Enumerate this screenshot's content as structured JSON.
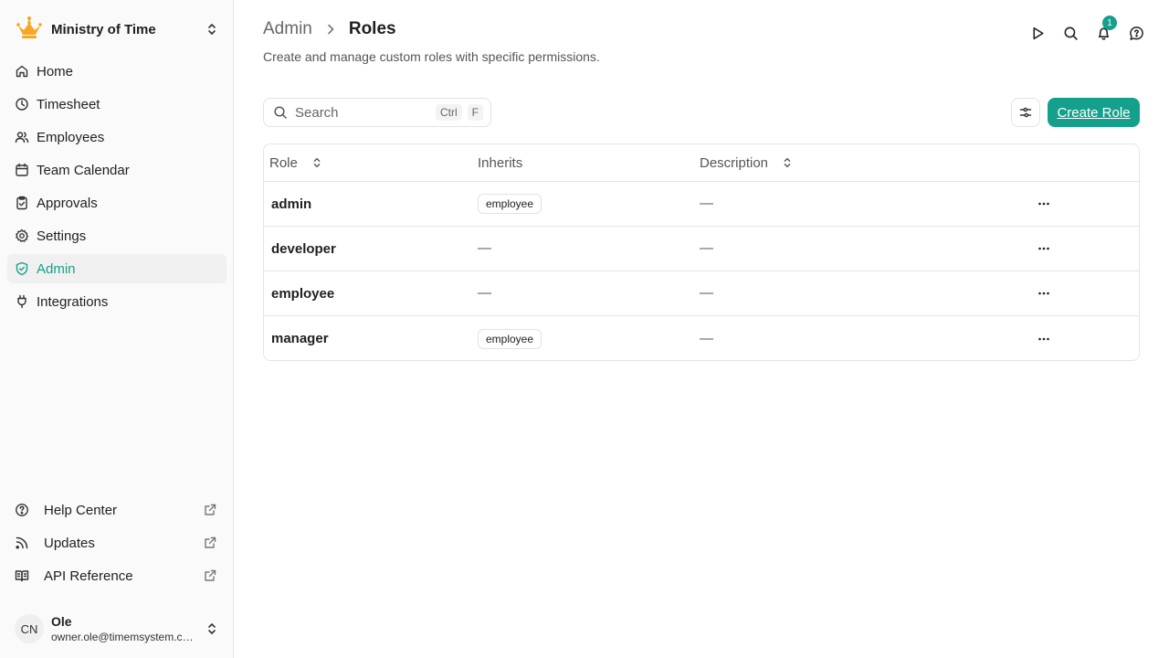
{
  "org": {
    "name": "Ministry of Time",
    "logo_icon": "crown-icon",
    "logo_color": "#f5a623"
  },
  "nav": {
    "items": [
      {
        "label": "Home",
        "icon": "home-icon"
      },
      {
        "label": "Timesheet",
        "icon": "clock-icon"
      },
      {
        "label": "Employees",
        "icon": "users-icon"
      },
      {
        "label": "Team Calendar",
        "icon": "calendar-icon"
      },
      {
        "label": "Approvals",
        "icon": "clipboard-check-icon"
      },
      {
        "label": "Settings",
        "icon": "gear-icon"
      },
      {
        "label": "Admin",
        "icon": "shield-check-icon",
        "active": true
      },
      {
        "label": "Integrations",
        "icon": "plug-icon"
      }
    ]
  },
  "footer_nav": {
    "items": [
      {
        "label": "Help Center",
        "icon": "help-circle-icon"
      },
      {
        "label": "Updates",
        "icon": "rss-icon"
      },
      {
        "label": "API Reference",
        "icon": "book-icon"
      }
    ]
  },
  "user": {
    "initials": "CN",
    "name": "Ole",
    "email": "owner.ole@timemsystem.com"
  },
  "breadcrumb": {
    "parent": "Admin",
    "current": "Roles"
  },
  "subtitle": "Create and manage custom roles with specific permissions.",
  "top_icons": {
    "notification_count": "1"
  },
  "search": {
    "placeholder": "Search",
    "value": "",
    "shortcut_ctrl": "Ctrl",
    "shortcut_key": "F"
  },
  "actions": {
    "create_label": "Create Role"
  },
  "table": {
    "headers": {
      "role": "Role",
      "inherits": "Inherits",
      "description": "Description"
    },
    "rows": [
      {
        "role": "admin",
        "inherits": "employee",
        "description": "—"
      },
      {
        "role": "developer",
        "inherits": "—",
        "description": "—"
      },
      {
        "role": "employee",
        "inherits": "—",
        "description": "—"
      },
      {
        "role": "manager",
        "inherits": "employee",
        "description": "—"
      }
    ]
  },
  "colors": {
    "accent": "#14a08d",
    "active_bg": "#f0f0f0"
  }
}
